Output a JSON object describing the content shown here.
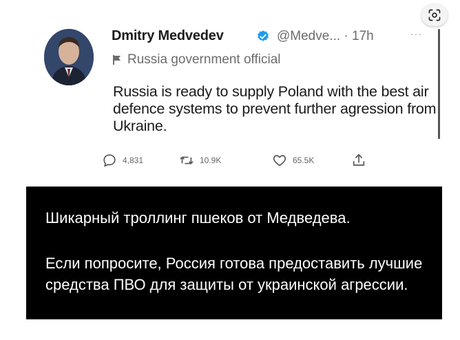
{
  "tweet": {
    "author_name": "Dmitry Medvedev",
    "handle_time": "@Medve... · 17h",
    "more": "···",
    "label": "Russia government official",
    "text": "Russia is ready to supply Poland with the best air defence systems to prevent further agression from Ukraine.",
    "actions": {
      "replies": "4,831",
      "retweets": "10.9K",
      "likes": "65.5K"
    }
  },
  "caption": {
    "line1": "Шикарный троллинг пшеков от Медведева.",
    "body": "Если попросите, Россия готова предоставить лучшие средства ПВО для защиты от украинской агрессии."
  },
  "icons": {
    "scan": "lens-scan-icon",
    "verified": "verified-badge-icon",
    "label": "flag-icon",
    "reply": "reply-icon",
    "retweet": "retweet-icon",
    "like": "heart-icon",
    "share": "share-icon"
  },
  "colors": {
    "verified": "#1d9bf0",
    "caption_bg": "#000000",
    "caption_text": "#ffffff",
    "meta_text": "#6c6c6c"
  }
}
